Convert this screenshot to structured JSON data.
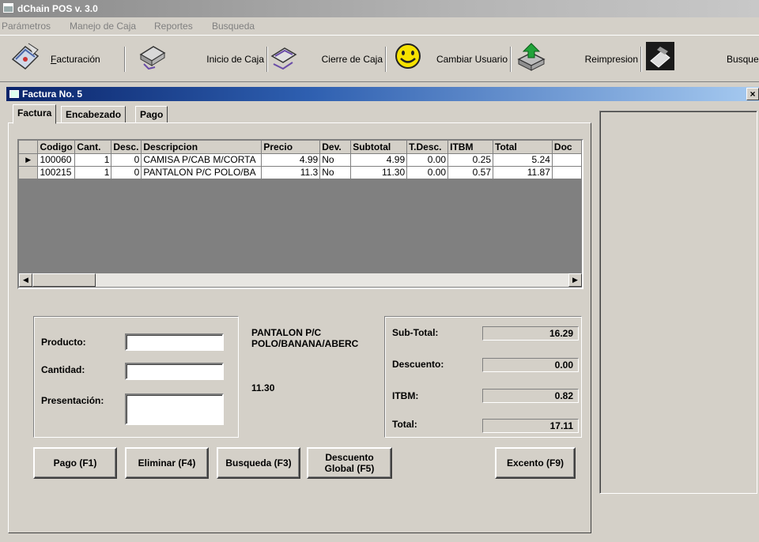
{
  "window": {
    "title": "dChain POS v. 3.0"
  },
  "menu": [
    "Parámetros",
    "Manejo de Caja",
    "Reportes",
    "Busqueda"
  ],
  "toolbar": [
    {
      "label": "Facturación",
      "icon": "invoice-icon"
    },
    {
      "label": "Inicio de Caja",
      "icon": "register-open-icon"
    },
    {
      "label": "Cierre de Caja",
      "icon": "register-close-icon"
    },
    {
      "label": "Cambiar Usuario",
      "icon": "smiley-icon"
    },
    {
      "label": "Reimpresion",
      "icon": "reprint-icon"
    },
    {
      "label": "Busqueda",
      "icon": "search-icon"
    }
  ],
  "subwindow": {
    "title": "Factura No. 5",
    "close": "×"
  },
  "tabs": [
    "Factura",
    "Encabezado",
    "Pago"
  ],
  "grid": {
    "columns": [
      "Codigo",
      "Cant.",
      "Desc.",
      "Descripcion",
      "Precio",
      "Dev.",
      "Subtotal",
      "T.Desc.",
      "ITBM",
      "Total",
      "Doc"
    ],
    "rows": [
      [
        "100060",
        "1",
        "0",
        "CAMISA P/CAB M/CORTA",
        "4.99",
        "No",
        "4.99",
        "0.00",
        "0.25",
        "5.24",
        ""
      ],
      [
        "100215",
        "1",
        "0",
        "PANTALON P/C POLO/BA",
        "11.3",
        "No",
        "11.30",
        "0.00",
        "0.57",
        "11.87",
        ""
      ]
    ]
  },
  "entry": {
    "producto_label": "Producto:",
    "cantidad_label": "Cantidad:",
    "presentacion_label": "Presentación:",
    "producto_value": "",
    "cantidad_value": "",
    "presentacion_value": ""
  },
  "selected_product": {
    "name_line1": "PANTALON P/C",
    "name_line2": "POLO/BANANA/ABERC",
    "price": "11.30"
  },
  "totals": {
    "subtotal_label": "Sub-Total:",
    "subtotal": "16.29",
    "descuento_label": "Descuento:",
    "descuento": "0.00",
    "itbm_label": "ITBM:",
    "itbm": "0.82",
    "total_label": "Total:",
    "total": "17.11"
  },
  "buttons": {
    "pago": "Pago (F1)",
    "eliminar": "Eliminar (F4)",
    "busqueda": "Busqueda (F3)",
    "descuento_line1": "Descuento",
    "descuento_line2": "Global (F5)",
    "excento": "Excento (F9)"
  }
}
